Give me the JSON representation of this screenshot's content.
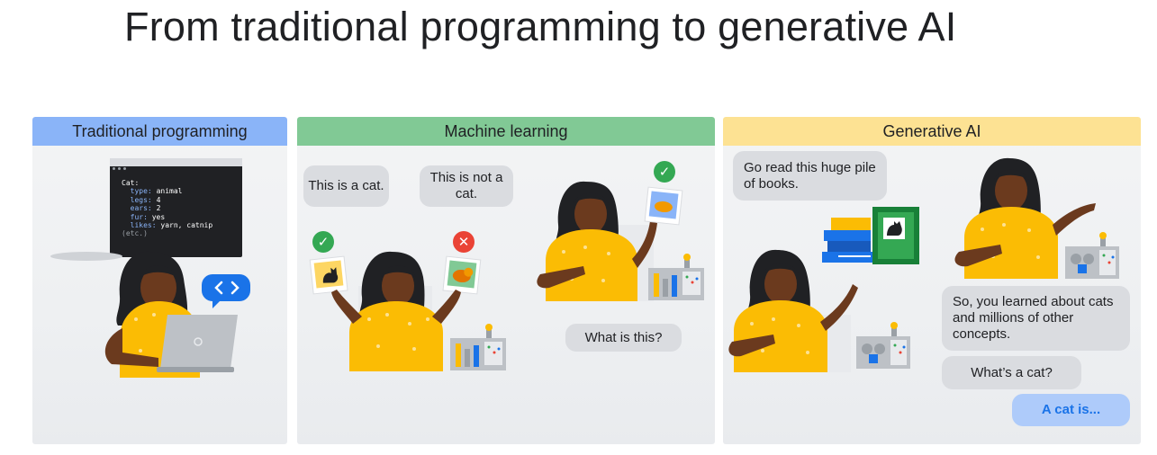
{
  "title": "From traditional programming to generative AI",
  "colors": {
    "traditional_header": "#8ab4f8",
    "ml_header": "#81c995",
    "genai_header": "#fde293",
    "bubble": "#dadce0",
    "answer_bubble": "#aecbfa",
    "answer_text": "#1a73e8",
    "skin": "#6b3a1e",
    "shirt": "#fbbc04"
  },
  "panels": {
    "traditional": {
      "header": "Traditional programming",
      "code_lines": {
        "l1": "Cat:",
        "l2_key": "type:",
        "l2_val": "animal",
        "l3_key": "legs:",
        "l3_val": "4",
        "l4_key": "ears:",
        "l4_val": "2",
        "l5_key": "fur:",
        "l5_val": "yes",
        "l6_key": "likes:",
        "l6_val": "yarn, catnip",
        "l7": "(etc.)"
      },
      "icons": [
        "code-brackets-icon",
        "laptop-icon",
        "person-icon"
      ]
    },
    "ml": {
      "header": "Machine learning",
      "bubble_cat": "This is a cat.",
      "bubble_not_cat": "This is not a cat.",
      "bubble_question": "What is this?",
      "icons": [
        "check-icon",
        "cross-icon",
        "cat-photo-icon",
        "dog-photo-icon",
        "machine-icon"
      ]
    },
    "genai": {
      "header": "Generative AI",
      "bubble_read": "Go read this huge pile of books.",
      "bubble_learned": "So, you learned about cats and millions of other concepts.",
      "bubble_whats_cat": "What’s a cat?",
      "bubble_answer": "A cat is...",
      "icons": [
        "books-icon",
        "cat-book-icon",
        "robot-machine-icon"
      ]
    }
  }
}
